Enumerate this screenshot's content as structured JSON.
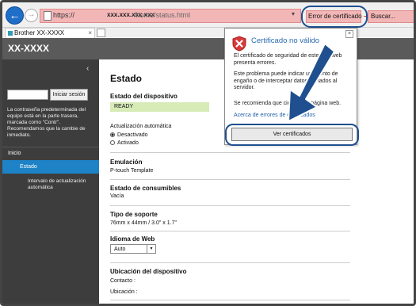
{
  "browser": {
    "url_protocol": "https://",
    "url_host": "xxx.xxx.xxx.xxx",
    "url_path": "/home/status.html",
    "cert_error_label": "Error de certificado",
    "search_placeholder": "Buscar...",
    "tab_title": "Brother XX-XXXX",
    "tab_close": "×",
    "back_icon": "←",
    "forward_icon": "→",
    "dropdown_icon": "▾",
    "cert_arrow_icon": "➔",
    "accent_color": "#1f4f8f",
    "error_color": "#f3b6b6"
  },
  "header": {
    "brand": "XX-XXXX"
  },
  "sidebar": {
    "collapse_icon": "‹",
    "login_button": "Iniciar sesión",
    "password_note": "La contraseña predeterminada del equipo está en la parte trasera, marcada como \"Contr\". Recomendamos que la cambie de inmediato.",
    "items": [
      {
        "label": "Inicio"
      },
      {
        "label": "Estado"
      },
      {
        "label": "Intervalo de actualización automática"
      }
    ]
  },
  "main": {
    "title": "Estado",
    "device_status": {
      "heading": "Estado del dispositivo",
      "value": "READY"
    },
    "auto_update": {
      "label": "Actualización automática",
      "options": [
        "Desactivado",
        "Activado"
      ]
    },
    "emulation": {
      "heading": "Emulación",
      "value": "P-touch Template"
    },
    "consumables": {
      "heading": "Estado de consumibles",
      "value": "Vacía"
    },
    "media": {
      "heading": "Tipo de soporte",
      "value": "76mm x 44mm / 3.0\" x 1.7\""
    },
    "web_language": {
      "heading": "Idioma de Web",
      "selected": "Auto"
    },
    "location": {
      "heading": "Ubicación del dispositivo",
      "contact_label": "Contacto :",
      "location_label": "Ubicación :"
    }
  },
  "cert_popup": {
    "title": "Certificado no válido",
    "close": "×",
    "para1": "El certificado de seguridad de este sitio web presenta errores.",
    "para2": "Este problema puede indicar un intento de engaño o de interceptar datos enviados al servidor.",
    "para3": "Se recomienda que cierre esta página web.",
    "link": "Acerca de errores de certificados",
    "button": "Ver certificados"
  }
}
